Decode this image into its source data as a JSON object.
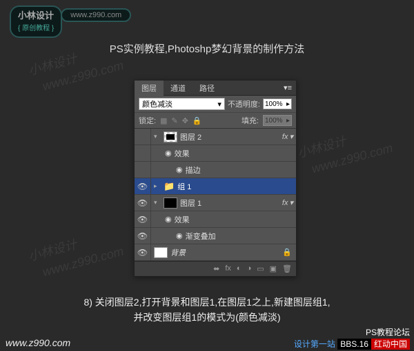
{
  "header": {
    "logo_main": "小林",
    "logo_sub_cn": "设计",
    "logo_tag": "{ 原创教程 }",
    "url": "www.z990.com"
  },
  "title": "PS实例教程,Photoshp梦幻背景的制作方法",
  "panel": {
    "tabs": {
      "t0": "图层",
      "t1": "通道",
      "t2": "路径"
    },
    "blend_mode": "颜色减淡",
    "opacity_label": "不透明度:",
    "opacity_value": "100%",
    "lock_label": "锁定:",
    "fill_label": "填充:",
    "fill_value": "100%"
  },
  "layers": {
    "l0": {
      "name": "图层 2"
    },
    "l0fx": {
      "name": "效果"
    },
    "l0fx1": {
      "name": "描边"
    },
    "l1": {
      "name": "组 1"
    },
    "l2": {
      "name": "图层 1"
    },
    "l2fx": {
      "name": "效果"
    },
    "l2fx1": {
      "name": "渐变叠加"
    },
    "l3": {
      "name": "背景"
    }
  },
  "caption": {
    "line1": "8) 关闭图层2,打开背景和图层1,在图层1之上,新建图层组1,",
    "line2": "并改变图层组1的模式为(颜色减淡)"
  },
  "footer": {
    "left": "www.z990.com",
    "right_title": "PS教程论坛",
    "right_sub": "设计第一站",
    "bbs": "BBS.",
    "num": "16",
    "red": "红动中国"
  },
  "watermarks": [
    "小林设计",
    "www.z990.com"
  ]
}
